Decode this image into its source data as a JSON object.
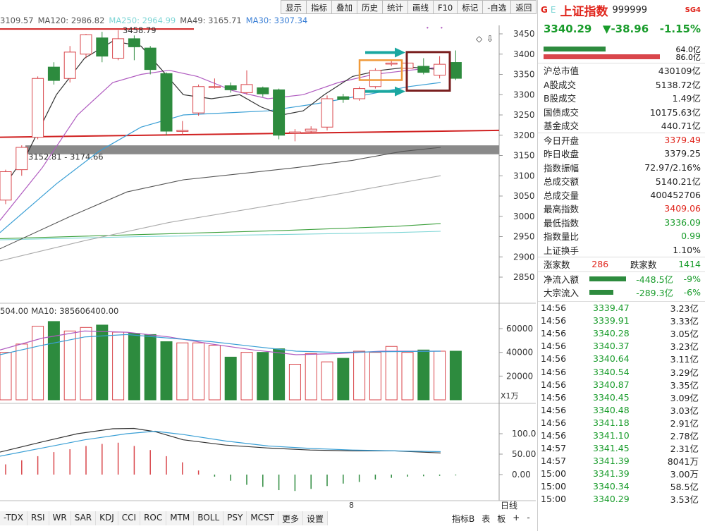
{
  "toolbar": [
    "显示",
    "指标",
    "叠加",
    "历史",
    "统计",
    "画线",
    "F10",
    "标记",
    "-自选",
    "返回"
  ],
  "ma_legend": [
    {
      "text": "3109.57",
      "color": "#555"
    },
    {
      "text": "MA120: 2986.82",
      "color": "#555"
    },
    {
      "text": "MA250: 2964.99",
      "color": "#7fd6d6"
    },
    {
      "text": "MA49: 3165.71",
      "color": "#555"
    },
    {
      "text": "MA30: 3307.34",
      "color": "#3a7fd5"
    }
  ],
  "price_axis": [
    "3450",
    "3400",
    "3350",
    "3300",
    "3250",
    "3200",
    "3150",
    "3100",
    "3050",
    "3000",
    "2950",
    "2900",
    "2850"
  ],
  "annotations": {
    "high_label": "3458.79",
    "range_label": "3152.81 - 3174.66"
  },
  "candles": [
    {
      "o": 3040,
      "c": 3110,
      "h": 3115,
      "l": 3030
    },
    {
      "o": 3115,
      "c": 3170,
      "h": 3175,
      "l": 3100
    },
    {
      "o": 3195,
      "c": 3340,
      "h": 3345,
      "l": 3190
    },
    {
      "o": 3368,
      "c": 3335,
      "h": 3380,
      "l": 3325
    },
    {
      "o": 3340,
      "c": 3405,
      "h": 3420,
      "l": 3330
    },
    {
      "o": 3400,
      "c": 3448,
      "h": 3450,
      "l": 3390
    },
    {
      "o": 3440,
      "c": 3395,
      "h": 3455,
      "l": 3380
    },
    {
      "o": 3390,
      "c": 3438,
      "h": 3459,
      "l": 3385
    },
    {
      "o": 3438,
      "c": 3418,
      "h": 3446,
      "l": 3385
    },
    {
      "o": 3415,
      "c": 3362,
      "h": 3420,
      "l": 3350
    },
    {
      "o": 3352,
      "c": 3210,
      "h": 3355,
      "l": 3200
    },
    {
      "o": 3210,
      "c": 3212,
      "h": 3235,
      "l": 3200
    },
    {
      "o": 3255,
      "c": 3320,
      "h": 3325,
      "l": 3248
    },
    {
      "o": 3320,
      "c": 3320,
      "h": 3340,
      "l": 3315
    },
    {
      "o": 3322,
      "c": 3312,
      "h": 3330,
      "l": 3305
    },
    {
      "o": 3305,
      "c": 3325,
      "h": 3360,
      "l": 3300
    },
    {
      "o": 3317,
      "c": 3302,
      "h": 3320,
      "l": 3295
    },
    {
      "o": 3312,
      "c": 3200,
      "h": 3315,
      "l": 3190
    },
    {
      "o": 3205,
      "c": 3208,
      "h": 3215,
      "l": 3185
    },
    {
      "o": 3210,
      "c": 3215,
      "h": 3222,
      "l": 3205
    },
    {
      "o": 3220,
      "c": 3290,
      "h": 3298,
      "l": 3212
    },
    {
      "o": 3295,
      "c": 3288,
      "h": 3302,
      "l": 3280
    },
    {
      "o": 3290,
      "c": 3315,
      "h": 3320,
      "l": 3285
    },
    {
      "o": 3320,
      "c": 3360,
      "h": 3365,
      "l": 3315
    },
    {
      "o": 3378,
      "c": 3378,
      "h": 3385,
      "l": 3370
    },
    {
      "o": 3365,
      "c": 3378,
      "h": 3388,
      "l": 3360
    },
    {
      "o": 3370,
      "c": 3355,
      "h": 3390,
      "l": 3350
    },
    {
      "o": 3348,
      "c": 3375,
      "h": 3395,
      "l": 3340
    },
    {
      "o": 3379.49,
      "c": 3340.29,
      "h": 3409.06,
      "l": 3336.09
    }
  ],
  "vol_legend": [
    {
      "text": "504.00",
      "color": "#333"
    },
    {
      "text": "MA10: 385606400.00",
      "color": "#333"
    }
  ],
  "vol_axis": [
    "60000",
    "40000",
    "20000"
  ],
  "vol_scale_label": "X1万",
  "volumes": [
    40000,
    47000,
    62000,
    66000,
    58000,
    61000,
    63000,
    57000,
    56000,
    55000,
    49000,
    48000,
    48000,
    46000,
    36000,
    40000,
    40000,
    43000,
    30000,
    39000,
    32000,
    35000,
    41000,
    40000,
    45000,
    40000,
    42000,
    41000,
    41000
  ],
  "macd_axis": [
    "100.0",
    "50.00",
    "0.00"
  ],
  "macd_bars": [
    25,
    35,
    45,
    55,
    62,
    70,
    75,
    78,
    70,
    60,
    45,
    30,
    10,
    -5,
    -15,
    -25,
    -30,
    -38,
    -40,
    -35,
    -28,
    -22,
    -18,
    -12,
    -8,
    -5,
    -4,
    -3,
    -2
  ],
  "x_axis_label": "8",
  "day_line": "日线",
  "bottom_tabs": [
    "-TDX",
    "RSI",
    "WR",
    "SAR",
    "KDJ",
    "CCI",
    "ROC",
    "MTM",
    "BOLL",
    "PSY",
    "MCST",
    "更多",
    "设置"
  ],
  "bottom_right": [
    "指标B",
    "表",
    "板",
    "+",
    "-"
  ],
  "quote": {
    "flag": "G",
    "small": "E",
    "name": "上证指数",
    "code": "999999",
    "badge": "SG4",
    "price": "3340.29",
    "change": "▼-38.96",
    "pct": "-1.15%",
    "bar1_pct": "64.0亿",
    "bar2_pct": "86.0亿",
    "bar1_fill": 0.64,
    "bar2_fill": 0.86,
    "rows": [
      {
        "label": "沪总市值",
        "value": "430109亿",
        "color": "#222"
      },
      {
        "label": "A股成交",
        "value": "5138.72亿",
        "color": "#222"
      },
      {
        "label": "B股成交",
        "value": "1.49亿",
        "color": "#222"
      },
      {
        "label": "国债成交",
        "value": "10175.63亿",
        "color": "#222"
      },
      {
        "label": "基金成交",
        "value": "440.71亿",
        "color": "#222"
      }
    ],
    "rows2": [
      {
        "label": "今日开盘",
        "value": "3379.49",
        "color": "#e0241b"
      },
      {
        "label": "昨日收盘",
        "value": "3379.25",
        "color": "#222"
      },
      {
        "label": "指数振幅",
        "value": "72.97/2.16%",
        "color": "#222"
      },
      {
        "label": "总成交额",
        "value": "5140.21亿",
        "color": "#222"
      },
      {
        "label": "总成交量",
        "value": "400452706",
        "color": "#222"
      },
      {
        "label": "最高指数",
        "value": "3409.06",
        "color": "#e0241b"
      },
      {
        "label": "最低指数",
        "value": "3336.09",
        "color": "#199c2b"
      },
      {
        "label": "指数量比",
        "value": "0.99",
        "color": "#199c2b"
      },
      {
        "label": "上证换手",
        "value": "1.10%",
        "color": "#222"
      }
    ],
    "up_label": "涨家数",
    "up_value": "286",
    "down_label": "跌家数",
    "down_value": "1414",
    "flow1_label": "净流入额",
    "flow1_value": "-448.5亿",
    "flow1_pct": "-9%",
    "flow2_label": "大宗流入",
    "flow2_value": "-289.3亿",
    "flow2_pct": "-6%"
  },
  "ticks": [
    {
      "t": "14:56",
      "p": "3339.47",
      "v": "3.23亿"
    },
    {
      "t": "14:56",
      "p": "3339.91",
      "v": "3.33亿"
    },
    {
      "t": "14:56",
      "p": "3340.28",
      "v": "3.05亿"
    },
    {
      "t": "14:56",
      "p": "3340.37",
      "v": "3.23亿"
    },
    {
      "t": "14:56",
      "p": "3340.64",
      "v": "3.11亿"
    },
    {
      "t": "14:56",
      "p": "3340.54",
      "v": "3.29亿"
    },
    {
      "t": "14:56",
      "p": "3340.87",
      "v": "3.35亿"
    },
    {
      "t": "14:56",
      "p": "3340.45",
      "v": "3.09亿"
    },
    {
      "t": "14:56",
      "p": "3340.48",
      "v": "3.03亿"
    },
    {
      "t": "14:56",
      "p": "3341.18",
      "v": "2.91亿"
    },
    {
      "t": "14:56",
      "p": "3341.10",
      "v": "2.78亿"
    },
    {
      "t": "14:57",
      "p": "3341.45",
      "v": "2.31亿"
    },
    {
      "t": "14:57",
      "p": "3341.39",
      "v": "8041万"
    },
    {
      "t": "15:00",
      "p": "3341.39",
      "v": "3.00万"
    },
    {
      "t": "15:00",
      "p": "3340.34",
      "v": "58.5亿"
    },
    {
      "t": "15:00",
      "p": "3340.29",
      "v": "3.53亿"
    }
  ]
}
